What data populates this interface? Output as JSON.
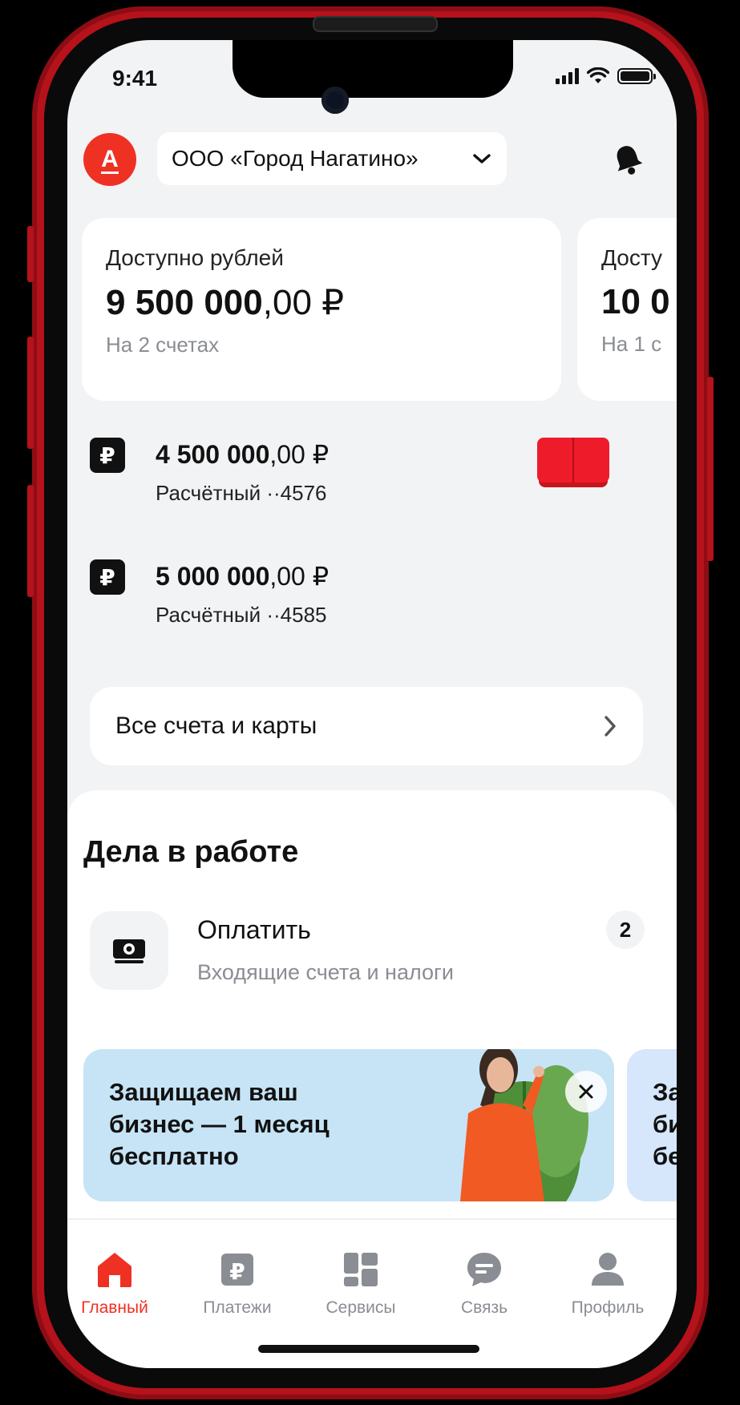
{
  "status_bar": {
    "time": "9:41"
  },
  "header": {
    "logo_letter": "А",
    "company_name": "ООО «Город Нагатино»"
  },
  "balances": [
    {
      "label": "Доступно рублей",
      "amount_int": "9 500 000",
      "amount_frac": ",00 ₽",
      "sub": "На 2 счетах"
    },
    {
      "label": "Досту",
      "amount_int": "10 0",
      "amount_frac": "",
      "sub": "На 1 с"
    }
  ],
  "accounts": [
    {
      "currency_symbol": "₽",
      "amount_int": "4 500 000",
      "amount_frac": ",00 ₽",
      "name": "Расчётный ··4576"
    },
    {
      "currency_symbol": "₽",
      "amount_int": "5 000 000",
      "amount_frac": ",00 ₽",
      "name": "Расчётный ··4585"
    }
  ],
  "all_accounts": {
    "label": "Все счета и карты"
  },
  "tasks": {
    "title": "Дела в работе",
    "items": [
      {
        "title": "Оплатить",
        "subtitle": "Входящие счета и налоги",
        "badge": "2"
      }
    ]
  },
  "promos": [
    {
      "text": "Защищаем ваш бизнес — 1 месяц бесплатно"
    },
    {
      "text": "За би бе"
    }
  ],
  "tabbar": {
    "items": [
      {
        "label": "Главный",
        "icon": "home-icon",
        "active": true
      },
      {
        "label": "Платежи",
        "icon": "payments-icon",
        "active": false
      },
      {
        "label": "Сервисы",
        "icon": "services-icon",
        "active": false
      },
      {
        "label": "Связь",
        "icon": "chat-icon",
        "active": false
      },
      {
        "label": "Профиль",
        "icon": "profile-icon",
        "active": false
      }
    ]
  },
  "colors": {
    "brand": "#ef3124",
    "background": "#f2f3f5",
    "card": "#ffffff",
    "muted_text": "#8a8d93",
    "promo_bg": "#c6e4f5",
    "phone_frame": "#b5121b"
  }
}
